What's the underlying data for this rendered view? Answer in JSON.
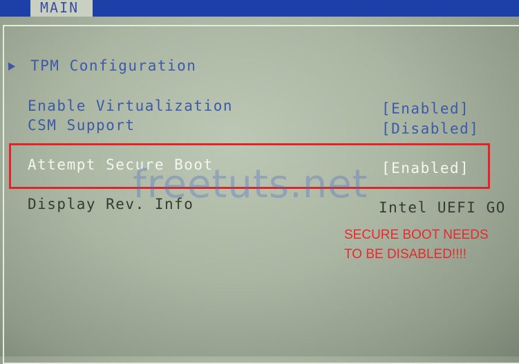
{
  "header": {
    "tab_main": "MAIN"
  },
  "menu": {
    "tpm": "TPM Configuration",
    "virtualization": {
      "label": "Enable Virtualization",
      "value": "[Enabled]"
    },
    "csm": {
      "label": "CSM Support",
      "value": "[Disabled]"
    },
    "secure_boot": {
      "label": "Attempt Secure Boot",
      "value": "[Enabled]"
    },
    "display_rev": {
      "label": "Display Rev. Info",
      "value": "Intel UEFI GO"
    }
  },
  "watermark": "freetuts.net",
  "annotation": {
    "line1": "SECURE BOOT NEEDS",
    "line2": "TO BE DISABLED!!!!"
  },
  "colors": {
    "bios_blue_text": "#3d5aa8",
    "top_bar": "#1d3fa8",
    "highlight_red": "#e0242a",
    "selected_text": "#f4f6f0"
  },
  "icons": {
    "submenu": "triangle-right-icon"
  }
}
